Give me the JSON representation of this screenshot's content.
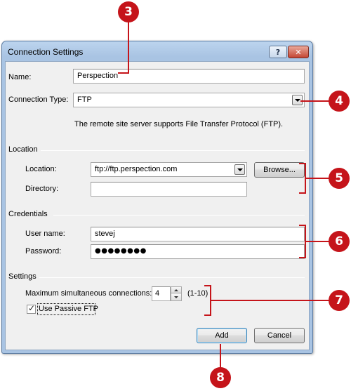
{
  "dialog": {
    "title": "Connection Settings",
    "help_glyph": "?",
    "close_glyph": "✕"
  },
  "form": {
    "name_label": "Name:",
    "name_value": "Perspection",
    "connection_type_label": "Connection Type:",
    "connection_type_value": "FTP",
    "description": "The remote site server supports File Transfer Protocol (FTP)."
  },
  "location_group": {
    "title": "Location",
    "location_label": "Location:",
    "location_value": "ftp://ftp.perspection.com",
    "browse_label": "Browse...",
    "directory_label": "Directory:",
    "directory_value": ""
  },
  "credentials_group": {
    "title": "Credentials",
    "username_label": "User name:",
    "username_value": "stevej",
    "password_label": "Password:",
    "password_value": "●●●●●●●●"
  },
  "settings_group": {
    "title": "Settings",
    "max_connections_label": "Maximum simultaneous connections:",
    "max_connections_value": "4",
    "range_hint": "(1-10)",
    "passive_ftp_label": "Use Passive FTP",
    "passive_ftp_checked": true,
    "check_glyph": "✓"
  },
  "buttons": {
    "add_label": "Add",
    "cancel_label": "Cancel"
  },
  "callouts": [
    "3",
    "4",
    "5",
    "6",
    "7",
    "8"
  ],
  "colors": {
    "callout": "#c5141a",
    "title_bar": "#a9c4e3",
    "close_button": "#c44634"
  }
}
